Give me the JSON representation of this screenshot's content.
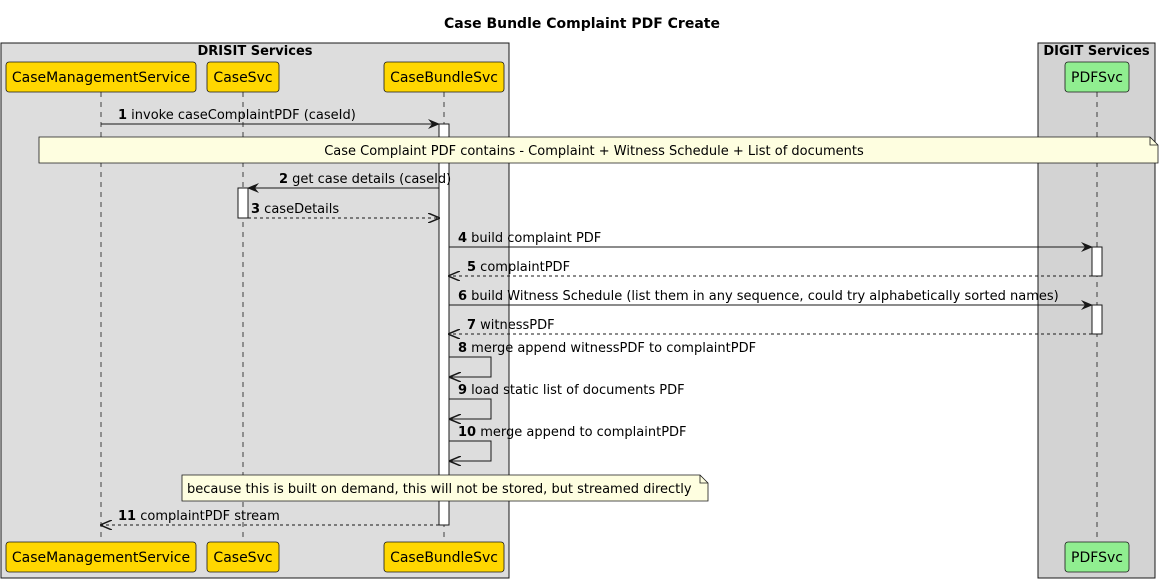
{
  "title": "Case Bundle Complaint PDF Create",
  "boxes": [
    {
      "id": "drisit",
      "title": "DRISIT Services",
      "color": "#dddddd"
    },
    {
      "id": "digit",
      "title": "DIGIT Services",
      "color": "#d3d3d3"
    }
  ],
  "participants": [
    {
      "id": "cms",
      "label": "CaseManagementService",
      "color": "#ffd700"
    },
    {
      "id": "cs",
      "label": "CaseSvc",
      "color": "#ffd700"
    },
    {
      "id": "cbs",
      "label": "CaseBundleSvc",
      "color": "#ffd700"
    },
    {
      "id": "pdf",
      "label": "PDFSvc",
      "color": "#90ee90"
    }
  ],
  "messages": [
    {
      "num": "1",
      "text": "invoke caseComplaintPDF (caseId)",
      "from": "cms",
      "to": "cbs",
      "style": "solid"
    },
    {
      "num": "2",
      "text": "get case details (caseId)",
      "from": "cbs",
      "to": "cs",
      "style": "solid"
    },
    {
      "num": "3",
      "text": "caseDetails",
      "from": "cs",
      "to": "cbs",
      "style": "dashed"
    },
    {
      "num": "4",
      "text": "build complaint PDF",
      "from": "cbs",
      "to": "pdf",
      "style": "solid"
    },
    {
      "num": "5",
      "text": "complaintPDF",
      "from": "pdf",
      "to": "cbs",
      "style": "dashed"
    },
    {
      "num": "6",
      "text": "build Witness Schedule (list them in any sequence, could try alphabetically sorted names)",
      "from": "cbs",
      "to": "pdf",
      "style": "solid"
    },
    {
      "num": "7",
      "text": "witnessPDF",
      "from": "pdf",
      "to": "cbs",
      "style": "dashed"
    },
    {
      "num": "8",
      "text": "merge append witnessPDF to complaintPDF",
      "from": "cbs",
      "to": "cbs",
      "style": "self"
    },
    {
      "num": "9",
      "text": "load static list of documents PDF",
      "from": "cbs",
      "to": "cbs",
      "style": "self"
    },
    {
      "num": "10",
      "text": "merge append to complaintPDF",
      "from": "cbs",
      "to": "cbs",
      "style": "self"
    },
    {
      "num": "11",
      "text": "complaintPDF stream",
      "from": "cbs",
      "to": "cms",
      "style": "dashed"
    }
  ],
  "notes": [
    {
      "id": "note-1",
      "text": "Case Complaint PDF contains - Complaint + Witness Schedule + List of documents",
      "color": "#fefee0"
    },
    {
      "id": "note-2",
      "text": "because this is built on demand, this will not be stored, but streamed directly",
      "color": "#fefee0"
    }
  ]
}
